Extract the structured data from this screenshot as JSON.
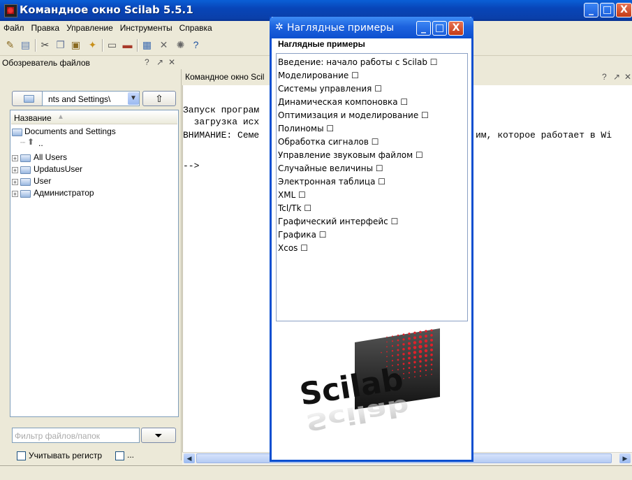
{
  "main_window": {
    "title": "Командное окно Scilab 5.5.1",
    "controls": [
      "_",
      "□",
      "X"
    ]
  },
  "menubar": [
    "Файл",
    "Правка",
    "Управление",
    "Инструменты",
    "Справка"
  ],
  "toolbar": [
    "new-file-icon",
    "open-file-icon",
    "cut-icon",
    "copy-icon",
    "paste-icon",
    "clear-icon",
    "print-icon",
    "printer-icon",
    "variable-browser-icon",
    "tools-icon",
    "gear-icon",
    "help-icon"
  ],
  "file_browser": {
    "title": "Обозреватель файлов",
    "header_controls": [
      "?",
      "↗",
      "✕"
    ],
    "path_value": "nts and Settings\\",
    "column_header": "Название",
    "root": "Documents and Settings",
    "up_item": "..",
    "items": [
      "All Users",
      "UpdatusUser",
      "User",
      "Администратор"
    ],
    "filter_placeholder": "Фильтр файлов/папок",
    "case_checkbox_label": "Учитывать регистр",
    "more_label": "..."
  },
  "console": {
    "tab_title": "Командное окно Scil",
    "header_controls": [
      "?",
      "↗",
      "✕"
    ],
    "lines": [
      "Запуск програм",
      "  загрузка исх",
      "ВНИМАНИЕ: Семе",
      "",
      "-->"
    ],
    "line_right": "им, которое работает в Wi"
  },
  "demos_window": {
    "title": "Наглядные примеры",
    "subtitle": "Наглядные примеры",
    "items": [
      "Введение: начало работы с Scilab ☐",
      "Моделирование ☐",
      "Системы управления ☐",
      "Динамическая компоновка ☐",
      "Оптимизация и моделирование ☐",
      "Полиномы ☐",
      "Обработка сигналов ☐",
      "Управление звуковым файлом ☐",
      "Случайные величины ☐",
      "Электронная таблица ☐",
      "XML ☐",
      "Tcl/Tk ☐",
      "Графический интерфейс ☐",
      "Графика ☐",
      "Xcos ☐"
    ],
    "logo_text": "Scilab"
  },
  "colors": {
    "titlebar_blue": "#0845b8",
    "window_bg": "#ece9d8",
    "close_red": "#c33a16",
    "logo_red": "#e0202a"
  }
}
